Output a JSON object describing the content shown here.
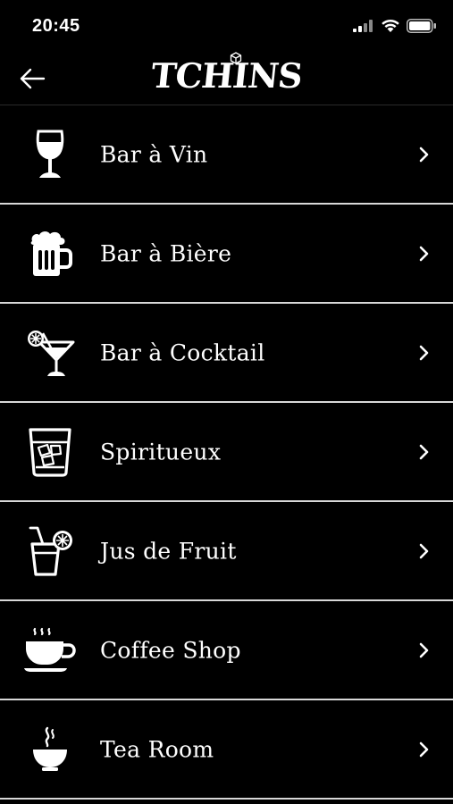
{
  "status": {
    "time": "20:45",
    "signal": "signal-icon",
    "wifi": "wifi-icon",
    "battery": "battery-icon"
  },
  "header": {
    "logo": "TCHINS",
    "back_icon": "back-arrow-icon"
  },
  "colors": {
    "background": "#000000",
    "text": "#ffffff",
    "divider": "#d8d8d8"
  },
  "menu": {
    "items": [
      {
        "label": "Bar à Vin",
        "icon": "wine-glass-icon"
      },
      {
        "label": "Bar à Bière",
        "icon": "beer-mug-icon"
      },
      {
        "label": "Bar à Cocktail",
        "icon": "cocktail-glass-icon"
      },
      {
        "label": "Spiritueux",
        "icon": "whisky-glass-icon"
      },
      {
        "label": "Jus de Fruit",
        "icon": "juice-glass-icon"
      },
      {
        "label": "Coffee Shop",
        "icon": "coffee-cup-icon"
      },
      {
        "label": "Tea Room",
        "icon": "tea-bowl-icon"
      }
    ]
  }
}
